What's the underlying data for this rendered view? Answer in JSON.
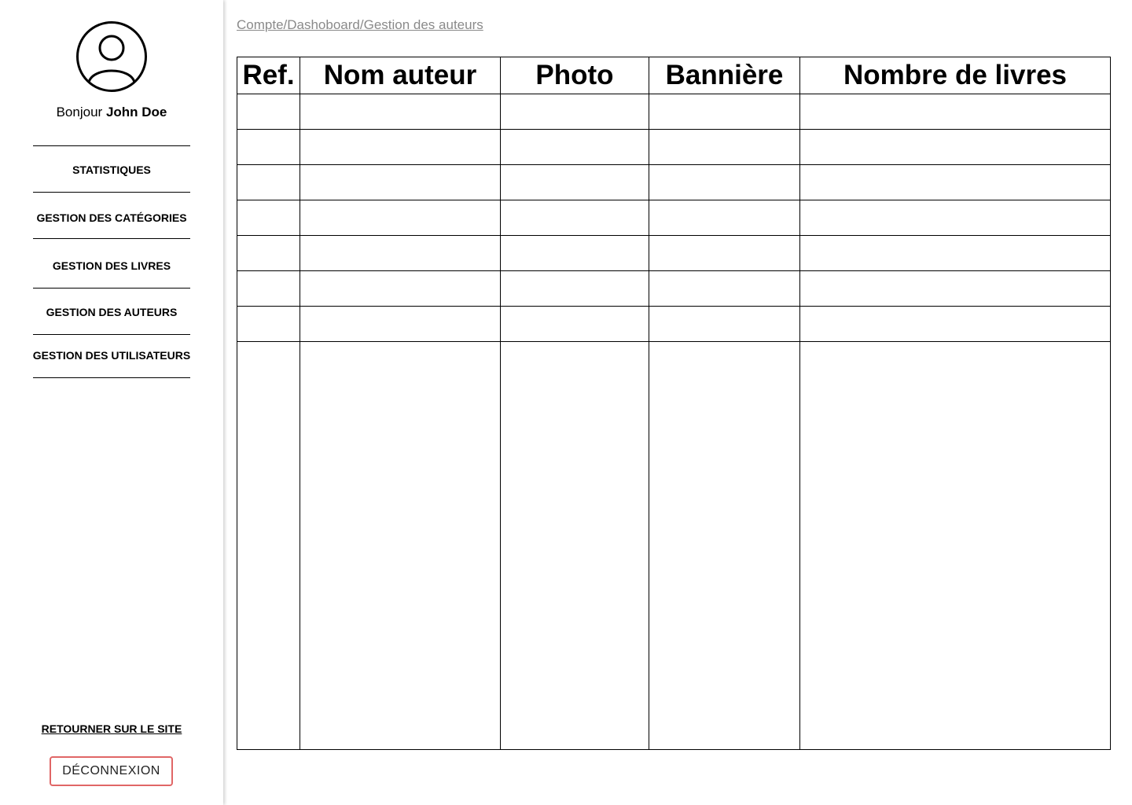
{
  "sidebar": {
    "greeting_prefix": "Bonjour",
    "user_name": "John Doe",
    "nav": [
      {
        "label": "STATISTIQUES"
      },
      {
        "label": "GESTION DES CATÉGORIES"
      },
      {
        "label": "GESTION DES LIVRES"
      },
      {
        "label": "GESTION DES AUTEURS"
      },
      {
        "label": "GESTION DES UTILISATEURS"
      }
    ],
    "back_link": "RETOURNER SUR LE SITE",
    "logout_label": "DÉCONNEXION",
    "avatar_icon": "user-circle-icon",
    "logout_border_color": "#e06666"
  },
  "breadcrumb": {
    "text": "Compte/Dashoboard/Gestion des auteurs",
    "color": "#8a8a8a"
  },
  "table": {
    "headers": [
      "Ref.",
      "Nom auteur",
      "Photo",
      "Bannière",
      "Nombre de livres"
    ],
    "empty_rows": 7
  }
}
